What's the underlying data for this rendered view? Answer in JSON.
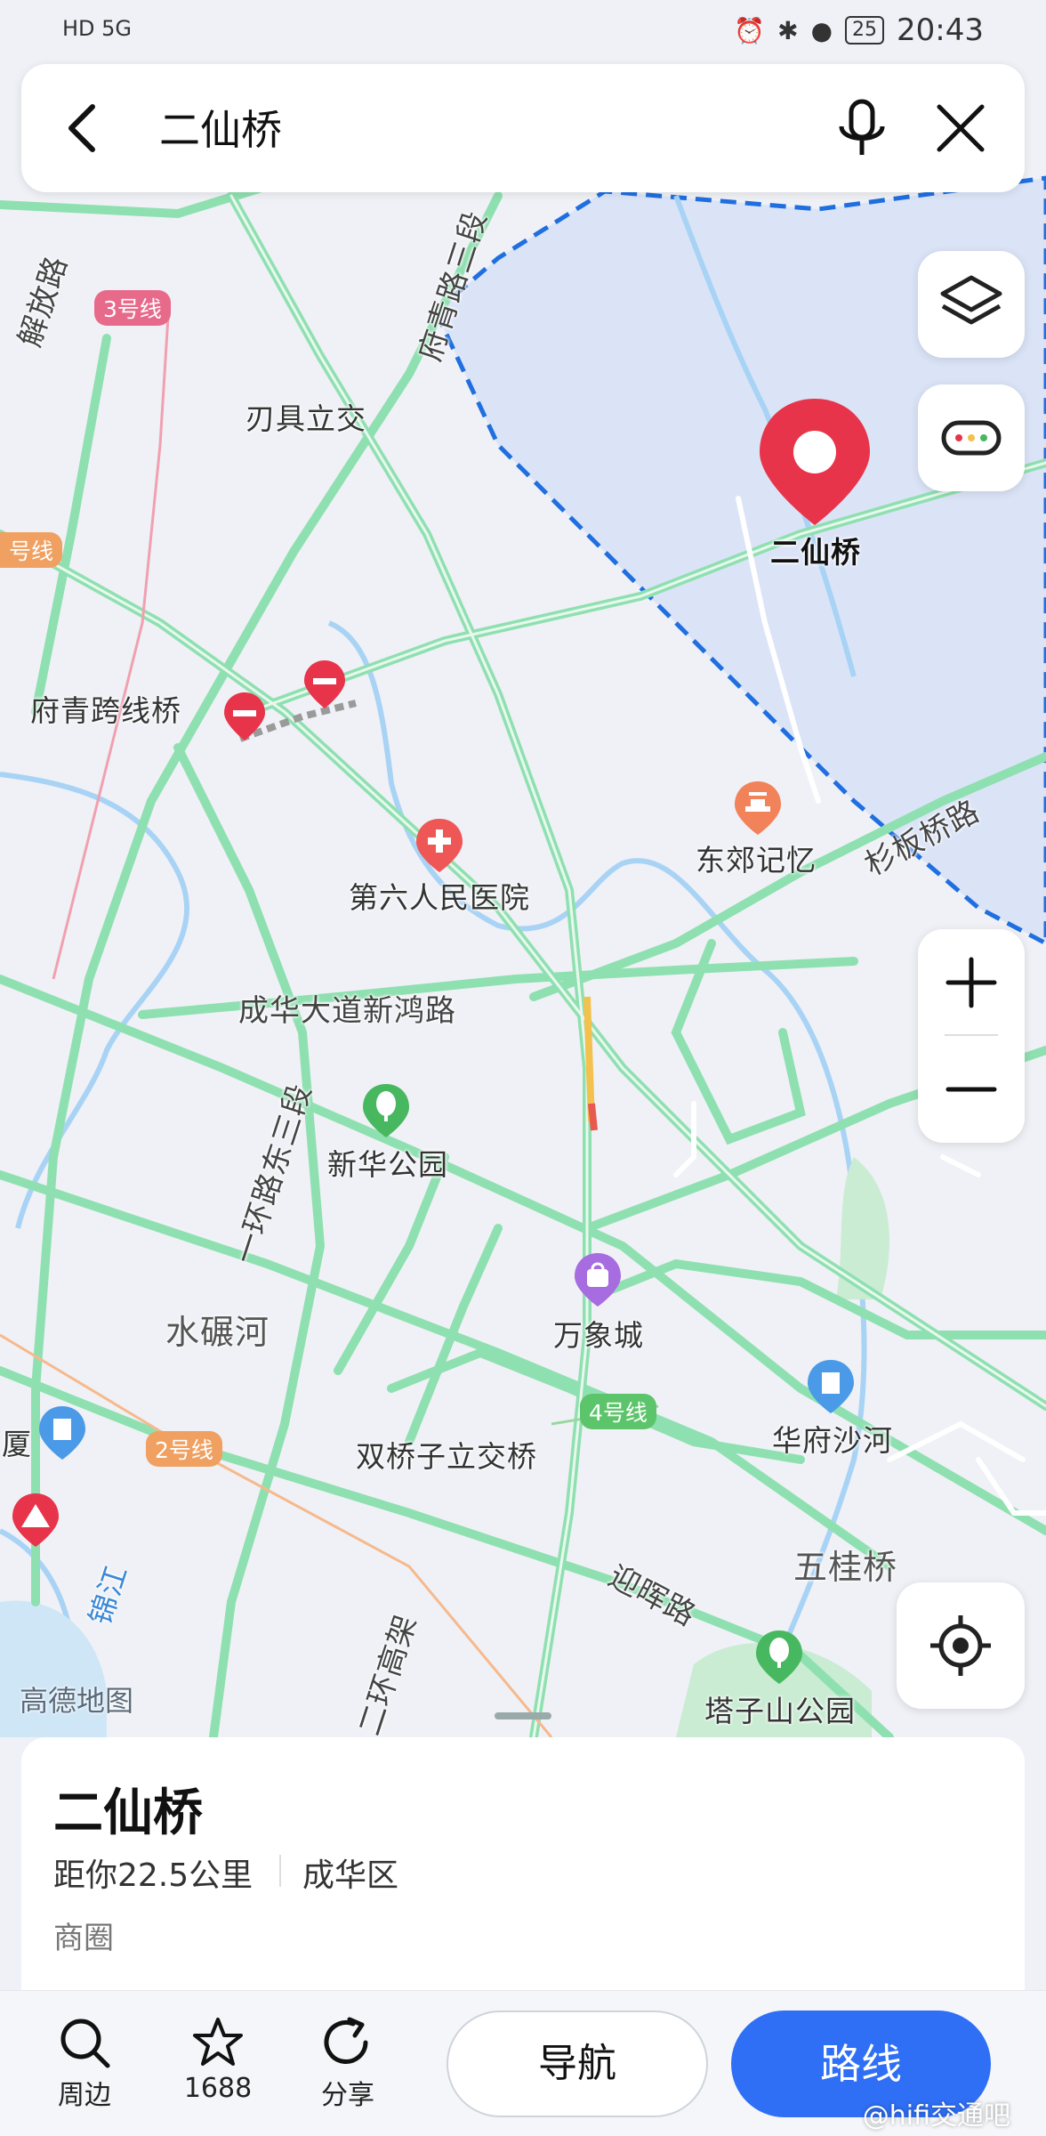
{
  "status_bar": {
    "left_icons": "HD 5G",
    "time": "20:43",
    "battery": "25"
  },
  "search": {
    "query": "二仙桥"
  },
  "map": {
    "pin_label": "二仙桥",
    "labels": {
      "renju": "刃具立交",
      "fuqing_bridge": "府青跨线桥",
      "hospital": "第六人民医院",
      "dongjiao": "东郊记忆",
      "chenghua_road": "成华大道新鸿路",
      "xinhua_park": "新华公园",
      "shuinian": "水碾河",
      "wanxiang": "万象城",
      "shuangqiaozi": "双桥子立交桥",
      "huafu": "华府沙河",
      "wugui": "五桂桥",
      "tazishan": "塔子山公园",
      "yinghui": "迎晖路",
      "shanban": "杉板桥路",
      "fuqing_road": "府青路三段",
      "jiefang": "解放路",
      "yihuan": "一环路东三段",
      "erhuan": "二环高架",
      "jinjiang": "锦江",
      "xia": "厦"
    },
    "metro": {
      "line3": "3号线",
      "line2": "2号线",
      "line4": "4号线",
      "line_left": "号线"
    },
    "logo": "高德地图"
  },
  "place_card": {
    "title": "二仙桥",
    "distance": "距你22.5公里",
    "district": "成华区",
    "category": "商圈"
  },
  "bottom_bar": {
    "nearby": "周边",
    "favorite_count": "1688",
    "share": "分享",
    "navigate": "导航",
    "route": "路线"
  },
  "watermark": "@hifi交通吧",
  "colors": {
    "accent": "#2f6ff5",
    "pin": "#e8344a",
    "road": "#8fe0b0",
    "water": "#9fd0f5",
    "area": "#dde6f7",
    "boundary": "#1f6fe0"
  }
}
